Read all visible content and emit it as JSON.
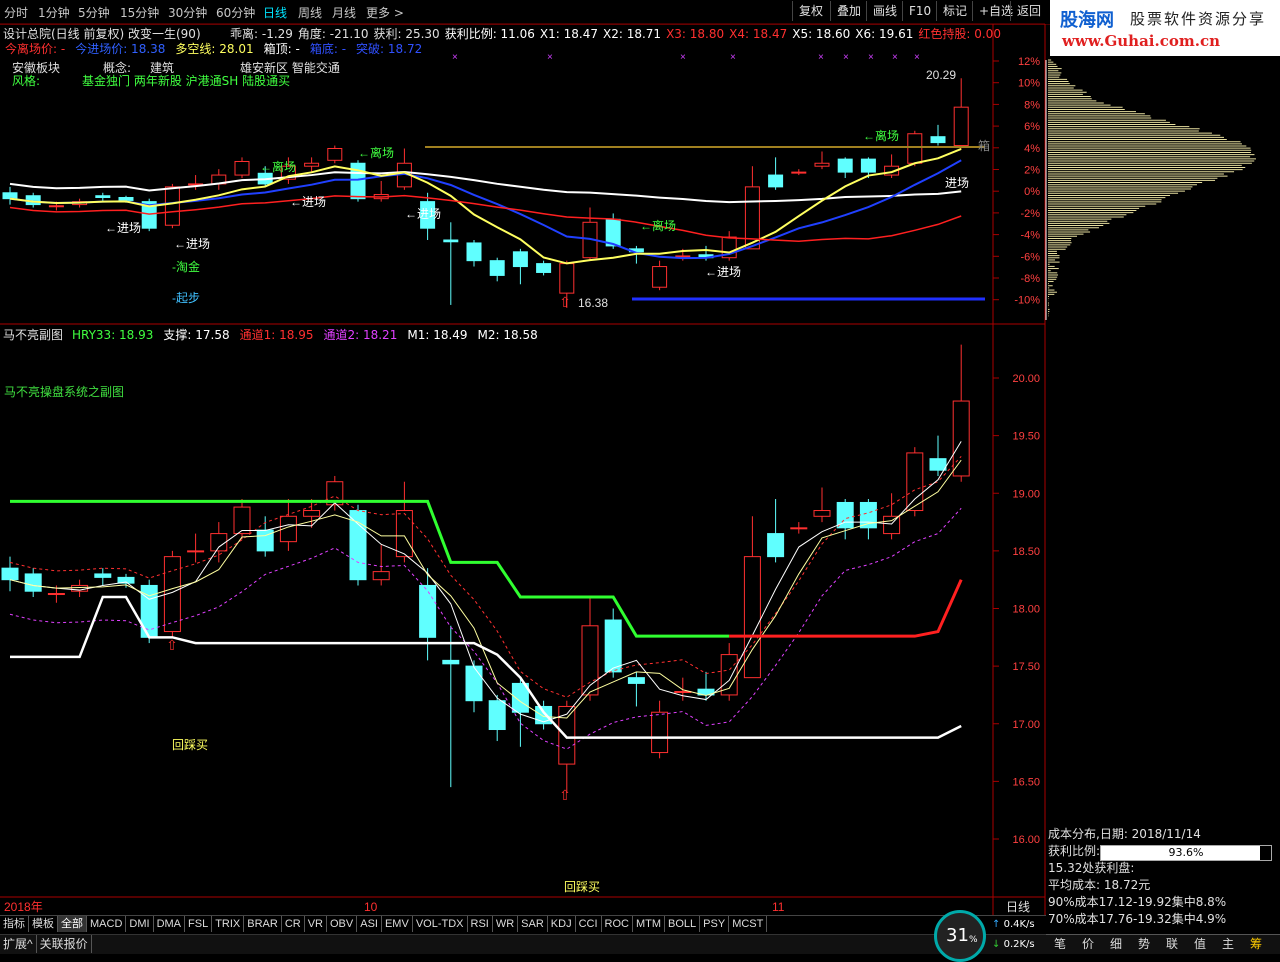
{
  "toolbar": {
    "periods": [
      "分时",
      "1分钟",
      "5分钟",
      "15分钟",
      "30分钟",
      "60分钟",
      "日线",
      "周线",
      "月线",
      "更多 >"
    ],
    "active": "日线",
    "buttons": [
      "复权",
      "叠加",
      "画线",
      "F10",
      "标记",
      "+自选",
      "返回"
    ],
    "extra": "60"
  },
  "logo": {
    "line1a": "股海网",
    "line1b": "股票软件资源分享",
    "line2": "www.Guhai.com.cn"
  },
  "main": {
    "title": "设计总院(日线 前复权) 改变一生(90)",
    "metrics": [
      {
        "label": "乖离: -1.29",
        "color": "#e0e0e0"
      },
      {
        "label": "角度: -21.10",
        "color": "#e0e0e0"
      },
      {
        "label": "获利: 25.30",
        "color": "#e0e0e0"
      },
      {
        "label": "获利比例: 11.06",
        "color": "#ffffff"
      },
      {
        "label": "X1: 18.47",
        "color": "#ffffff"
      },
      {
        "label": "X2: 18.71",
        "color": "#ffffff"
      },
      {
        "label": "X3: 18.80",
        "color": "#ff3030"
      },
      {
        "label": "X4: 18.47",
        "color": "#ff3030"
      },
      {
        "label": "X5: 18.60",
        "color": "#ffffff"
      },
      {
        "label": "X6: 19.61",
        "color": "#ffffff"
      },
      {
        "label": "红色持股: 0.00",
        "color": "#ff3030"
      }
    ],
    "line2": [
      {
        "label": "今离场价: -",
        "color": "#ff3030"
      },
      {
        "label": "今进场价: 18.38",
        "color": "#3060ff"
      },
      {
        "label": "多空线: 28.01",
        "color": "#ffff60"
      },
      {
        "label": "箱顶: -",
        "color": "#ffffff"
      },
      {
        "label": "箱底: -",
        "color": "#3050ff"
      },
      {
        "label": "突破: 18.72",
        "color": "#3050ff"
      }
    ],
    "sector": {
      "label1": "安徽板块",
      "concept_label": "概念:",
      "concept": "建筑",
      "tags1": "雄安新区 智能交通",
      "style_label": "风格:",
      "tags2": "基金独门 两年新股 沪港通SH 陆股通买"
    },
    "annotations": [
      "←进场",
      "←进场",
      "←进场",
      "←进场",
      "←进场",
      "←离场",
      "←离场",
      "←离场",
      "←离场",
      "-淘金",
      "-起步",
      "进场",
      "箱"
    ],
    "hi_label": "20.29",
    "lo_label": "16.38",
    "axis": [
      "12%",
      "10%",
      "8%",
      "6%",
      "4%",
      "2%",
      "0%",
      "-2%",
      "-4%",
      "-6%",
      "-8%",
      "-10%"
    ]
  },
  "sub": {
    "title": "马不亮副图",
    "metrics": [
      {
        "label": "HRY33: 18.93",
        "color": "#40ff40"
      },
      {
        "label": "支撑: 17.58",
        "color": "#ffffff"
      },
      {
        "label": "通道1: 18.95",
        "color": "#ff3030"
      },
      {
        "label": "通道2: 18.21",
        "color": "#e040ff"
      },
      {
        "label": "M1: 18.49",
        "color": "#ffffff"
      },
      {
        "label": "M2: 18.58",
        "color": "#ffffff"
      }
    ],
    "system_name": "马不亮操盘系统之副图",
    "notes": [
      "回踩买",
      "回踩买"
    ],
    "axis": [
      "20.00",
      "19.50",
      "19.00",
      "18.50",
      "18.00",
      "17.50",
      "17.00",
      "16.50",
      "16.00"
    ]
  },
  "chart_data": {
    "type": "candlestick",
    "ylim": [
      16.0,
      20.3
    ],
    "candles": [
      {
        "o": 18.35,
        "c": 18.25,
        "h": 18.45,
        "l": 18.15
      },
      {
        "o": 18.3,
        "c": 18.15,
        "h": 18.35,
        "l": 18.1
      },
      {
        "o": 18.13,
        "c": 18.13,
        "h": 18.2,
        "l": 18.05
      },
      {
        "o": 18.15,
        "c": 18.2,
        "h": 18.25,
        "l": 18.1
      },
      {
        "o": 18.3,
        "c": 18.27,
        "h": 18.35,
        "l": 18.2
      },
      {
        "o": 18.27,
        "c": 18.22,
        "h": 18.3,
        "l": 18.18
      },
      {
        "o": 18.2,
        "c": 17.75,
        "h": 18.25,
        "l": 17.7
      },
      {
        "o": 17.8,
        "c": 18.45,
        "h": 18.5,
        "l": 17.75
      },
      {
        "o": 18.5,
        "c": 18.5,
        "h": 18.65,
        "l": 18.4
      },
      {
        "o": 18.5,
        "c": 18.65,
        "h": 18.75,
        "l": 18.4
      },
      {
        "o": 18.65,
        "c": 18.88,
        "h": 18.95,
        "l": 18.6
      },
      {
        "o": 18.68,
        "c": 18.5,
        "h": 18.8,
        "l": 18.45
      },
      {
        "o": 18.58,
        "c": 18.8,
        "h": 18.95,
        "l": 18.5
      },
      {
        "o": 18.8,
        "c": 18.85,
        "h": 18.95,
        "l": 18.7
      },
      {
        "o": 18.9,
        "c": 19.1,
        "h": 19.15,
        "l": 18.85
      },
      {
        "o": 18.85,
        "c": 18.25,
        "h": 18.9,
        "l": 18.2
      },
      {
        "o": 18.25,
        "c": 18.32,
        "h": 18.55,
        "l": 18.2
      },
      {
        "o": 18.45,
        "c": 18.85,
        "h": 19.1,
        "l": 18.4
      },
      {
        "o": 18.2,
        "c": 17.75,
        "h": 18.35,
        "l": 17.55
      },
      {
        "o": 17.55,
        "c": 17.52,
        "h": 17.85,
        "l": 16.45
      },
      {
        "o": 17.5,
        "c": 17.2,
        "h": 17.55,
        "l": 17.1
      },
      {
        "o": 17.2,
        "c": 16.95,
        "h": 17.25,
        "l": 16.85
      },
      {
        "o": 17.35,
        "c": 17.1,
        "h": 17.4,
        "l": 16.8
      },
      {
        "o": 17.15,
        "c": 17.0,
        "h": 17.2,
        "l": 16.95
      },
      {
        "o": 16.65,
        "c": 17.15,
        "h": 17.2,
        "l": 16.4
      },
      {
        "o": 17.25,
        "c": 17.85,
        "h": 18.1,
        "l": 17.2
      },
      {
        "o": 17.9,
        "c": 17.45,
        "h": 18.0,
        "l": 17.4
      },
      {
        "o": 17.4,
        "c": 17.35,
        "h": 17.45,
        "l": 17.15
      },
      {
        "o": 16.75,
        "c": 17.1,
        "h": 17.2,
        "l": 16.7
      },
      {
        "o": 17.28,
        "c": 17.28,
        "h": 17.4,
        "l": 17.2
      },
      {
        "o": 17.3,
        "c": 17.25,
        "h": 17.45,
        "l": 17.2
      },
      {
        "o": 17.25,
        "c": 17.6,
        "h": 17.7,
        "l": 17.2
      },
      {
        "o": 17.4,
        "c": 18.45,
        "h": 18.8,
        "l": 17.4
      },
      {
        "o": 18.65,
        "c": 18.45,
        "h": 18.95,
        "l": 18.4
      },
      {
        "o": 18.7,
        "c": 18.7,
        "h": 18.75,
        "l": 18.65
      },
      {
        "o": 18.8,
        "c": 18.85,
        "h": 19.05,
        "l": 18.75
      },
      {
        "o": 18.92,
        "c": 18.7,
        "h": 18.95,
        "l": 18.6
      },
      {
        "o": 18.92,
        "c": 18.7,
        "h": 18.95,
        "l": 18.6
      },
      {
        "o": 18.65,
        "c": 18.8,
        "h": 19.0,
        "l": 18.6
      },
      {
        "o": 18.85,
        "c": 19.35,
        "h": 19.4,
        "l": 18.8
      },
      {
        "o": 19.3,
        "c": 19.2,
        "h": 19.5,
        "l": 19.15
      },
      {
        "o": 19.15,
        "c": 19.8,
        "h": 20.29,
        "l": 19.1
      }
    ]
  },
  "info": {
    "title": "成本分布,日期: 2018/11/14",
    "profit_label": "获利比例:",
    "profit_value": "93.6%",
    "profit_ratio": 0.936,
    "line3": "15.32处获利盘:",
    "line4": "平均成本: 18.72元",
    "line5": "90%成本17.12-19.92集中8.8%",
    "line6": "70%成本17.76-19.32集中4.9%"
  },
  "dates": {
    "d1": "2018年",
    "d2": "10",
    "d3": "11",
    "period": "日线"
  },
  "bottom_tabs": [
    "指标",
    "模板",
    "全部",
    "MACD",
    "DMI",
    "DMA",
    "FSL",
    "TRIX",
    "BRAR",
    "CR",
    "VR",
    "OBV",
    "ASI",
    "EMV",
    "VOL-TDX",
    "RSI",
    "WR",
    "SAR",
    "KDJ",
    "CCI",
    "ROC",
    "MTM",
    "BOLL",
    "PSY",
    "MCST"
  ],
  "bottom2": [
    "扩展^",
    "关联报价"
  ],
  "right_tabs": [
    "笔",
    "价",
    "细",
    "势",
    "联",
    "值",
    "主",
    "筹"
  ],
  "speed": {
    "percent": "31",
    "up": "0.4K/s",
    "down": "0.2K/s"
  }
}
